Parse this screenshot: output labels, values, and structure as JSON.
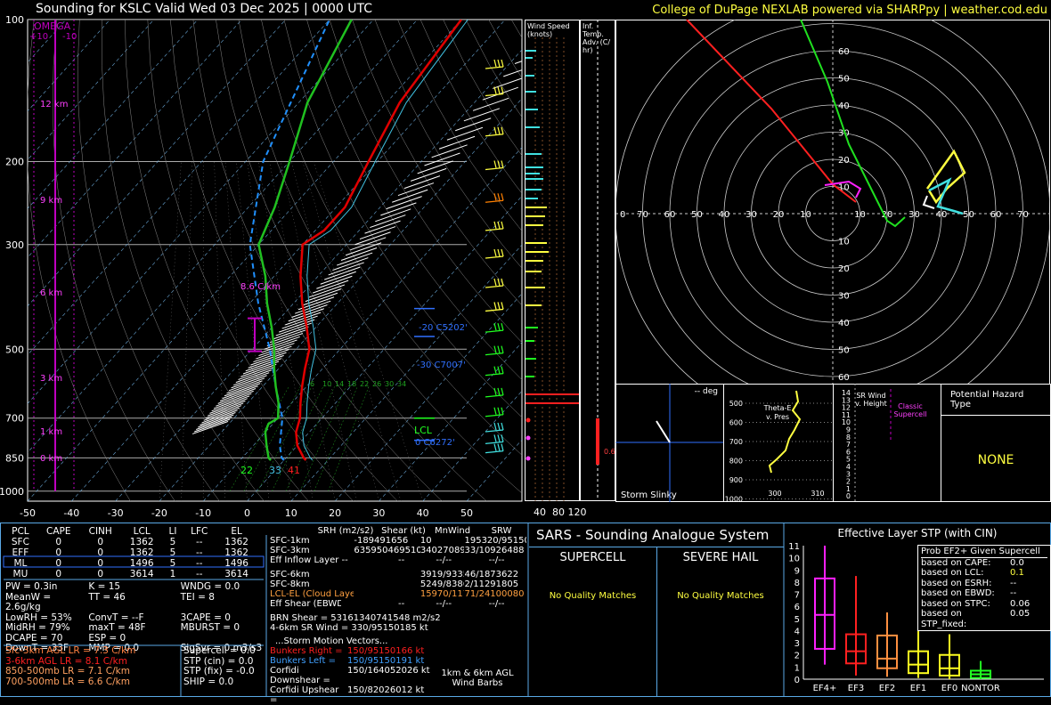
{
  "header": {
    "title": "Sounding for KSLC Valid  Wed 03 Dec 2025 | 0000 UTC",
    "credit": "College of DuPage NEXLAB powered via SHARPpy | weather.cod.edu"
  },
  "colors": {
    "temp": "#e00000",
    "dewp": "#20c020",
    "virt": "#e00000",
    "wetbulb": "#30c0e0",
    "parcel": "#ffffff",
    "omega": "#c000c0",
    "yellow": "#ffff40",
    "cyan": "#40e0e0",
    "magenta": "#ff40ff",
    "blue": "#3070ff",
    "frame": "#5aa9e6"
  },
  "skewt": {
    "pressure_ticks": [
      "100",
      "200",
      "300",
      "500",
      "700",
      "850",
      "1000"
    ],
    "temp_ticks": [
      "-50",
      "-40",
      "-30",
      "-20",
      "-10",
      "0",
      "10",
      "20",
      "30",
      "40",
      "50"
    ],
    "height_labels": [
      "12 km",
      "9 km",
      "6 km",
      "3 km",
      "1 km",
      "0 km"
    ],
    "omega": {
      "label": "OMEGA",
      "plus": "+10",
      "minus": "-10"
    },
    "lapse_label": "8.6 C/km",
    "sfc_values": {
      "td": "22",
      "tw": "33",
      "t": "41"
    },
    "lcl": "LCL",
    "level_labels": [
      "-20 C5202'",
      "-30 C7007'",
      "0 C6272'"
    ],
    "mix_labels": [
      "6",
      "10",
      "14",
      "18",
      "22",
      "26",
      "30",
      "34"
    ],
    "right_labels": [
      "8193638'"
    ]
  },
  "chart_data": {
    "type": "line",
    "title": "Sounding for KSLC Valid  Wed 03 Dec 2025 | 0000 UTC",
    "xlabel": "",
    "ylabel": "",
    "series": [],
    "temperature_profile": [
      [
        860,
        5
      ],
      [
        850,
        4
      ],
      [
        800,
        0
      ],
      [
        750,
        -3
      ],
      [
        700,
        -5
      ],
      [
        650,
        -8
      ],
      [
        600,
        -11
      ],
      [
        550,
        -14
      ],
      [
        500,
        -17
      ],
      [
        450,
        -22
      ],
      [
        400,
        -28
      ],
      [
        350,
        -34
      ],
      [
        300,
        -40
      ],
      [
        280,
        -38
      ],
      [
        250,
        -38
      ],
      [
        200,
        -42
      ],
      [
        150,
        -47
      ],
      [
        100,
        -50
      ]
    ],
    "dewpoint_profile": [
      [
        860,
        -3
      ],
      [
        850,
        -4
      ],
      [
        800,
        -7
      ],
      [
        750,
        -10
      ],
      [
        720,
        -11
      ],
      [
        700,
        -10
      ],
      [
        650,
        -13
      ],
      [
        600,
        -17
      ],
      [
        550,
        -21
      ],
      [
        500,
        -25
      ],
      [
        450,
        -30
      ],
      [
        400,
        -36
      ],
      [
        350,
        -42
      ],
      [
        300,
        -50
      ],
      [
        250,
        -54
      ],
      [
        200,
        -60
      ],
      [
        150,
        -68
      ],
      [
        100,
        -75
      ]
    ],
    "xlim": [
      -50,
      50
    ],
    "ylim": [
      1050,
      100
    ],
    "grid": true
  },
  "wind_panel": {
    "title": "Wind Speed (knots)",
    "ticks": [
      "40",
      "80",
      "120"
    ]
  },
  "adv_panel": {
    "title": "Inf. Temp. Adv. (C/ hr)",
    "value": "0.6"
  },
  "hodograph": {
    "rings": [
      "10",
      "20",
      "30",
      "40",
      "50",
      "60",
      "70"
    ]
  },
  "slinky": {
    "label": "Storm Slinky",
    "deg": "-- deg"
  },
  "theta": {
    "title": "Theta-E v. Pres",
    "pticks": [
      "500",
      "600",
      "700",
      "800",
      "900",
      "1000"
    ],
    "xticks": [
      "300",
      "310"
    ]
  },
  "srwind": {
    "title": "SR Wind v. Height",
    "classic": "Classic Supercell",
    "ticks": [
      "14",
      "13",
      "12",
      "11",
      "10",
      "9",
      "8",
      "7",
      "6",
      "5",
      "4",
      "3",
      "2",
      "1",
      "0"
    ]
  },
  "hazard": {
    "title": "Potential Hazard Type",
    "value": "NONE"
  },
  "parcels": {
    "headers": [
      "PCL",
      "CAPE",
      "CINH",
      "LCL",
      "LI",
      "LFC",
      "EL"
    ],
    "rows": [
      [
        "SFC",
        "0",
        "0",
        "1362",
        "5",
        "--",
        "1362"
      ],
      [
        "EFF",
        "0",
        "0",
        "1362",
        "5",
        "--",
        "1362"
      ],
      [
        "ML",
        "0",
        "0",
        "1496",
        "5",
        "--",
        "1496"
      ],
      [
        "MU",
        "0",
        "0",
        "3614",
        "1",
        "--",
        "3614"
      ]
    ]
  },
  "indices": [
    [
      "PW = 0.3in",
      "K = 15",
      "WNDG = 0.0"
    ],
    [
      "MeanW = 2.6g/kg",
      "TT = 46",
      "TEI = 8"
    ],
    [
      "LowRH = 53%",
      "ConvT = --F",
      "3CAPE = 0"
    ],
    [
      "MidRH = 79%",
      "maxT = 48F",
      "MBURST = 0"
    ],
    [
      "DCAPE = 70",
      "ESP = 0",
      ""
    ],
    [
      "DownT = 33F",
      "MMP = 0.0",
      "SigSvr = 0 m3/s3"
    ]
  ],
  "lapse": [
    "Sfc-3km AGL LR = 7.3 C/km",
    "3-6km AGL LR = 8.1 C/km",
    "850-500mb LR = 7.1 C/km",
    "700-500mb LR = 6.6 C/km"
  ],
  "composite": [
    "Supercell = 0.0",
    "STP (cin) = 0.0",
    "STP (fix) = -0.0",
    "SHIP = 0.0"
  ],
  "kinematic": {
    "headers": [
      "SRH (m2/s2)",
      "Shear (kt)",
      "MnWind",
      "SRW"
    ],
    "rows": [
      [
        "SFC-1km",
        "-189491656",
        "10",
        "195320/95150162"
      ],
      [
        "SFC-3km",
        "6359504695100416",
        "3402708937/10563541",
        "33/10926488"
      ],
      [
        "Eff Inflow Layer",
        "--",
        "--",
        "--/--",
        "--/--"
      ],
      [
        "SFC-6km",
        "",
        "3919/93351648",
        "46/1873622"
      ],
      [
        "SFC-8km",
        "",
        "5249/83869332",
        "2/11291805"
      ],
      [
        "LCL-EL (Cloud Layer)",
        "",
        "15970/11794421",
        "71/24100080"
      ],
      [
        "Eff Shear (EBWD)",
        "",
        "--",
        "--/--",
        "--/--"
      ]
    ],
    "brn": "BRN Shear = 53161340741548 m2/s2",
    "srw46": "4-6km SR Wind =  330/95150185 kt",
    "storm_title": "...Storm Motion Vectors...",
    "storm": [
      [
        "Bunkers Right =",
        "150/95150166 kt"
      ],
      [
        "Bunkers Left =",
        "150/95150191 kt"
      ],
      [
        "Corfidi Downshear =",
        "150/164052026 kt"
      ],
      [
        "Corfidi Upshear =",
        "150/82026012 kt"
      ]
    ],
    "barb_label": "1km & 6km AGL Wind Barbs"
  },
  "sars": {
    "title": "SARS - Sounding Analogue System",
    "supercell": "SUPERCELL",
    "hail": "SEVERE HAIL",
    "none1": "No Quality Matches",
    "none2": "No Quality Matches"
  },
  "stp": {
    "title": "Effective Layer STP (with CIN)",
    "yticks": [
      "11",
      "10",
      "9",
      "8",
      "7",
      "6",
      "5",
      "4",
      "3",
      "2",
      "1",
      "0"
    ],
    "cats": [
      "EF4+",
      "EF3",
      "EF2",
      "EF1",
      "EF0",
      "NONTOR"
    ],
    "boxes": [
      [
        1.2,
        2.5,
        5.3,
        8.3,
        11
      ],
      [
        0.3,
        1.3,
        2.3,
        3.7,
        8.5
      ],
      [
        0.2,
        0.9,
        1.7,
        3.6,
        5.5
      ],
      [
        0.1,
        0.5,
        1.2,
        2.3,
        4
      ],
      [
        0.0,
        0.3,
        0.9,
        2.0,
        3.7
      ],
      [
        0,
        0.1,
        0.4,
        0.7,
        1.5
      ]
    ],
    "colors": [
      "#ff20ff",
      "#ff2020",
      "#ff9040",
      "#ffff20",
      "#ffff20",
      "#20ff20"
    ],
    "prob_title": "Prob EF2+ Given Supercell",
    "prob": [
      [
        "based on CAPE:",
        "0.0"
      ],
      [
        "based on LCL:",
        "0.1"
      ],
      [
        "based on ESRH:",
        "--"
      ],
      [
        "based on EBWD:",
        "--"
      ],
      [
        "based on STPC:",
        "0.06"
      ],
      [
        "based on STP_fixed:",
        "0.05"
      ]
    ]
  }
}
